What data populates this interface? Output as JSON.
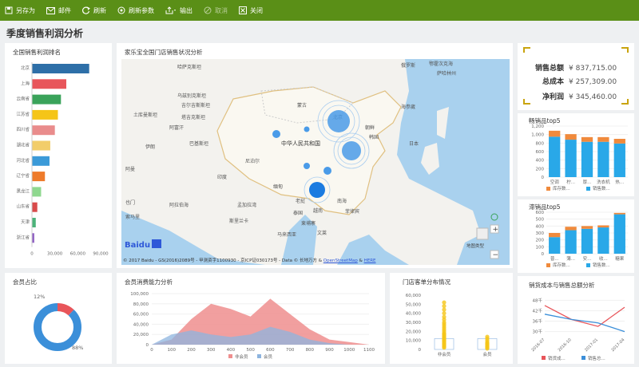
{
  "toolbar": {
    "save_as": "另存为",
    "email": "邮件",
    "refresh": "刷新",
    "refresh_params": "刷新参数",
    "export": "输出",
    "cancel": "取消",
    "close": "关闭"
  },
  "page_title": "季度销售利润分析",
  "ranking": {
    "title": "全国销售利润排名",
    "chart_data": {
      "type": "bar",
      "orientation": "horizontal",
      "categories": [
        "北京",
        "上海",
        "云南省",
        "江苏省",
        "四川省",
        "湖北省",
        "河北省",
        "辽宁省",
        "黑龙江",
        "山东省",
        "天津",
        "浙江省"
      ],
      "values": [
        75000,
        45000,
        38000,
        34000,
        30000,
        24000,
        23000,
        17000,
        12000,
        7000,
        5000,
        3000
      ],
      "colors": [
        "#2e6fa8",
        "#e8555a",
        "#3aa35a",
        "#f5c518",
        "#e98c8c",
        "#f2cd6a",
        "#3b9ad8",
        "#ee7b2b",
        "#8fd88f",
        "#d94b4b",
        "#4cb37a",
        "#8e5ec2"
      ],
      "xlim": [
        0,
        90000
      ],
      "xticks": [
        "0",
        "30,000",
        "60,000",
        "90,000"
      ]
    }
  },
  "map": {
    "title": "家乐宝全国门店销售状况分析",
    "labels": {
      "kazakhstan": "哈萨克斯坦",
      "mongolia": "蒙古",
      "china": "中华人民共和国",
      "japan": "日本",
      "kyrgyzstan": "吉尔吉斯斯坦",
      "uzbekistan": "乌兹别克斯坦",
      "turkmenistan": "土库曼斯坦",
      "tajikistan": "塔吉克斯坦",
      "afghanistan": "阿富汗",
      "iran": "伊朗",
      "pakistan": "巴基斯坦",
      "nepal": "尼泊尔",
      "india": "印度",
      "oman": "阿曼",
      "arabian_sea": "阿拉伯海",
      "bay_of_bengal": "孟加拉湾",
      "myanmar": "缅甸",
      "laos": "老挝",
      "thailand": "泰国",
      "vietnam": "越南",
      "cambodia": "柬埔寨",
      "philippines": "菲律宾",
      "malaysia": "马来西亚",
      "sri_lanka": "斯里兰卡",
      "brunei": "文莱",
      "south_korea": "韩国",
      "beijing": "北京",
      "south_china_sea": "南海",
      "sea_of_okhotsk": "鄂霍次克海",
      "sakhalin": "萨哈林州",
      "russia": "俄罗斯",
      "north_korea": "朝鲜",
      "vladivostok": "海参崴",
      "yemen": "也门",
      "somalia": "索马里"
    },
    "logo": "Baidu",
    "copyright": "© 2017 Baidu - GS(2016)2089号 - 甲测资字1100930 - 京ICP证030173号 - Data © 长地万方 & ",
    "osm": "OpenStreetMap",
    "amp": " & ",
    "here": "HERE",
    "map_type": "地图类型",
    "zoom_in": "+",
    "zoom_out": "−"
  },
  "kpis": [
    {
      "label": "销售总额",
      "value": "¥ 837,715.00"
    },
    {
      "label": "总成本",
      "value": "¥ 257,309.00"
    },
    {
      "label": "净利润",
      "value": "¥ 345,460.00"
    }
  ],
  "best_sellers": {
    "title": "畅销品top5",
    "legend": [
      "库存数...",
      "销售数..."
    ],
    "colors": [
      "#f08a3c",
      "#29a8e8"
    ],
    "chart_data": {
      "type": "bar",
      "stacked": true,
      "categories": [
        "空调",
        "柠...",
        "厚...",
        "洗衣机",
        "热..."
      ],
      "series": [
        {
          "name": "库存数...",
          "values": [
            140,
            130,
            110,
            110,
            110
          ]
        },
        {
          "name": "销售数...",
          "values": [
            950,
            880,
            830,
            830,
            790
          ]
        }
      ],
      "ylim": [
        0,
        1200
      ],
      "yticks": [
        "0",
        "200",
        "400",
        "600",
        "800",
        "1,000",
        "1,200"
      ]
    }
  },
  "slow_sellers": {
    "title": "滞销品top5",
    "legend": [
      "库存数...",
      "销售数..."
    ],
    "colors": [
      "#f08a3c",
      "#29a8e8"
    ],
    "chart_data": {
      "type": "bar",
      "stacked": true,
      "categories": [
        "普...",
        "薄...",
        "安...",
        "收...",
        "糖果"
      ],
      "series": [
        {
          "name": "库存数...",
          "values": [
            60,
            50,
            40,
            30,
            20
          ]
        },
        {
          "name": "销售数...",
          "values": [
            240,
            340,
            360,
            380,
            570
          ]
        }
      ],
      "ylim": [
        0,
        600
      ],
      "yticks": [
        "0",
        "100",
        "200",
        "300",
        "400",
        "500",
        "600"
      ]
    }
  },
  "member_ratio": {
    "title": "会员占比",
    "chart_data": {
      "type": "pie",
      "labels": [
        "非会员",
        "会员"
      ],
      "values": [
        12,
        88
      ],
      "percent_labels": [
        "12%",
        "88%"
      ],
      "colors": [
        "#e8555a",
        "#3b8fd9"
      ]
    }
  },
  "consumption": {
    "title": "会员消费能力分析",
    "legend": [
      "非会员",
      "会员"
    ],
    "chart_data": {
      "type": "area",
      "x": [
        0,
        100,
        200,
        300,
        400,
        500,
        600,
        700,
        800,
        900,
        1000,
        1100
      ],
      "series": [
        {
          "name": "非会员",
          "values": [
            0,
            10000,
            50000,
            80000,
            70000,
            55000,
            90000,
            60000,
            30000,
            10000,
            5000,
            0
          ],
          "color": "#ef8e8e"
        },
        {
          "name": "会员",
          "values": [
            0,
            20000,
            28000,
            20000,
            15000,
            20000,
            35000,
            25000,
            10000,
            3000,
            0,
            0
          ],
          "color": "#8db4df"
        }
      ],
      "ylim": [
        0,
        100000
      ],
      "yticks": [
        "0",
        "20,000",
        "40,000",
        "60,000",
        "80,000",
        "100,000"
      ],
      "xticks": [
        "0",
        "100",
        "200",
        "300",
        "400",
        "500",
        "600",
        "700",
        "800",
        "900",
        "1000",
        "1100"
      ]
    }
  },
  "store_orders": {
    "title": "门店客单分布情况",
    "chart_data": {
      "type": "scatter",
      "categories": [
        "非会员",
        "会员"
      ],
      "yticks": [
        "0",
        "10,000",
        "20,000",
        "30,000",
        "40,000",
        "50,000",
        "60,000"
      ],
      "ylim": [
        0,
        60000
      ]
    }
  },
  "cost_vs_sales": {
    "title": "销货成本与销售总额分析",
    "legend": [
      "销货成...",
      "销售总..."
    ],
    "chart_data": {
      "type": "line",
      "categories": [
        "2016-07",
        "2016-10",
        "2017-01",
        "2017-04"
      ],
      "series": [
        {
          "name": "销货成...",
          "values": [
            45000,
            37000,
            33000,
            44000
          ],
          "color": "#e8555a"
        },
        {
          "name": "销售总...",
          "values": [
            40000,
            37000,
            35000,
            30000
          ],
          "color": "#3b8fd9"
        }
      ],
      "yticks": [
        "30千",
        "36千",
        "42千",
        "48千"
      ],
      "ylim": [
        28000,
        50000
      ]
    }
  }
}
